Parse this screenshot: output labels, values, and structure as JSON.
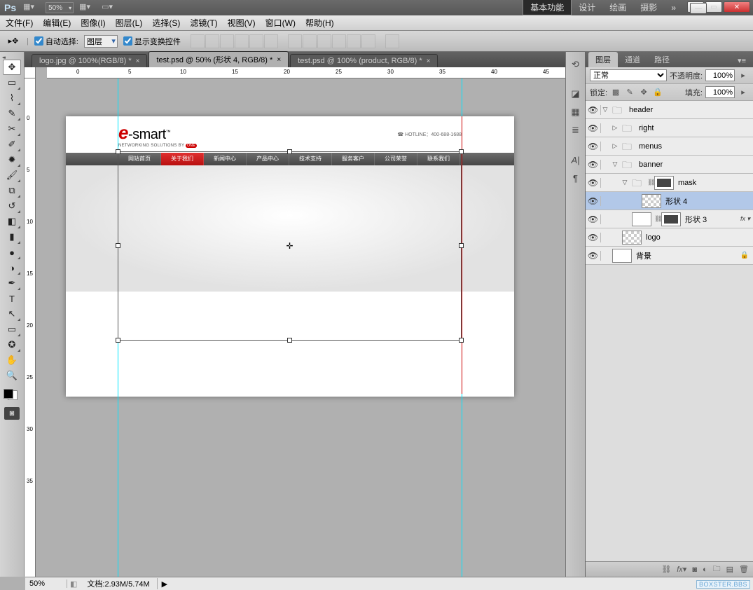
{
  "titlebar": {
    "zoom": "50%",
    "workspaces": [
      "基本功能",
      "设计",
      "绘画",
      "摄影"
    ],
    "active_ws": 0
  },
  "menus": [
    "文件(F)",
    "编辑(E)",
    "图像(I)",
    "图层(L)",
    "选择(S)",
    "滤镜(T)",
    "视图(V)",
    "窗口(W)",
    "帮助(H)"
  ],
  "options": {
    "auto_select_label": "自动选择:",
    "auto_select_value": "图层",
    "show_transform_label": "显示变换控件",
    "auto_checked": true,
    "show_checked": true
  },
  "tabs": [
    {
      "label": "logo.jpg @ 100%(RGB/8) *",
      "active": false
    },
    {
      "label": "test.psd @ 50% (形状 4, RGB/8) *",
      "active": true
    },
    {
      "label": "test.psd @ 100% (product, RGB/8) *",
      "active": false
    }
  ],
  "rulers_h": [
    "0",
    "5",
    "10",
    "15",
    "20",
    "25",
    "30",
    "35",
    "40",
    "45"
  ],
  "rulers_v": [
    "0",
    "5",
    "10",
    "15",
    "20",
    "25",
    "30",
    "35"
  ],
  "site": {
    "logo_main": "smart",
    "logo_sub": "NETWORKING SOLUTIONS BY",
    "hotline": "HOTLINE：400-688-1688",
    "nav": [
      "网站首页",
      "关于我们",
      "新闻中心",
      "产品中心",
      "技术支持",
      "服务客户",
      "公司荣誉",
      "联系我们"
    ],
    "nav_active": 1
  },
  "panel": {
    "tabs": [
      "图层",
      "通道",
      "路径"
    ],
    "blend": "正常",
    "opacity_label": "不透明度:",
    "opacity": "100%",
    "lock_label": "锁定:",
    "fill_label": "填充:",
    "fill": "100%"
  },
  "layers": [
    {
      "eye": true,
      "indent": 0,
      "arrow": "▽",
      "type": "folder",
      "name": "header"
    },
    {
      "eye": true,
      "indent": 1,
      "arrow": "▷",
      "type": "folder",
      "name": "right"
    },
    {
      "eye": true,
      "indent": 1,
      "arrow": "▷",
      "type": "folder",
      "name": "menus"
    },
    {
      "eye": true,
      "indent": 1,
      "arrow": "▽",
      "type": "folder",
      "name": "banner"
    },
    {
      "eye": true,
      "indent": 2,
      "arrow": "▽",
      "type": "folder-masked",
      "name": "mask"
    },
    {
      "eye": true,
      "indent": 3,
      "arrow": "",
      "type": "shape-trans",
      "name": "形状 4",
      "selected": true
    },
    {
      "eye": true,
      "indent": 2,
      "arrow": "",
      "type": "shape-mask",
      "name": "形状 3",
      "fx": true
    },
    {
      "eye": true,
      "indent": 1,
      "arrow": "",
      "type": "trans",
      "name": "logo"
    },
    {
      "eye": true,
      "indent": 0,
      "arrow": "",
      "type": "bg",
      "name": "背景",
      "locked": true
    }
  ],
  "status": {
    "zoom": "50%",
    "doc": "文档:2.93M/5.74M"
  },
  "watermark": "BOXSTER.BBS"
}
